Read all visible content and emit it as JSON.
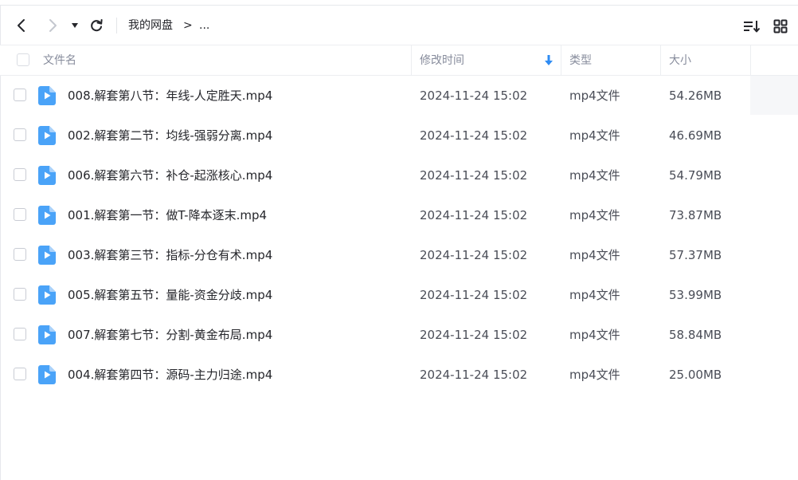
{
  "toolbar": {
    "breadcrumb_root": "我的网盘",
    "breadcrumb_sep": ">",
    "breadcrumb_more": "..."
  },
  "columns": {
    "name": "文件名",
    "modified": "修改时间",
    "type": "类型",
    "size": "大小"
  },
  "colors": {
    "accent": "#2f8cf3",
    "icon_blue": "#4aa3f8",
    "border": "#eceef1"
  },
  "files": [
    {
      "name": "008.解套第八节：年线-人定胜天.mp4",
      "modified": "2024-11-24 15:02",
      "type": "mp4文件",
      "size": "54.26MB"
    },
    {
      "name": "002.解套第二节：均线-强弱分离.mp4",
      "modified": "2024-11-24 15:02",
      "type": "mp4文件",
      "size": "46.69MB"
    },
    {
      "name": "006.解套第六节：补仓-起涨核心.mp4",
      "modified": "2024-11-24 15:02",
      "type": "mp4文件",
      "size": "54.79MB"
    },
    {
      "name": "001.解套第一节：做T-降本逐末.mp4",
      "modified": "2024-11-24 15:02",
      "type": "mp4文件",
      "size": "73.87MB"
    },
    {
      "name": "003.解套第三节：指标-分仓有术.mp4",
      "modified": "2024-11-24 15:02",
      "type": "mp4文件",
      "size": "57.37MB"
    },
    {
      "name": "005.解套第五节：量能-资金分歧.mp4",
      "modified": "2024-11-24 15:02",
      "type": "mp4文件",
      "size": "53.99MB"
    },
    {
      "name": "007.解套第七节：分割-黄金布局.mp4",
      "modified": "2024-11-24 15:02",
      "type": "mp4文件",
      "size": "58.84MB"
    },
    {
      "name": "004.解套第四节：源码-主力归途.mp4",
      "modified": "2024-11-24 15:02",
      "type": "mp4文件",
      "size": "25.00MB"
    }
  ]
}
